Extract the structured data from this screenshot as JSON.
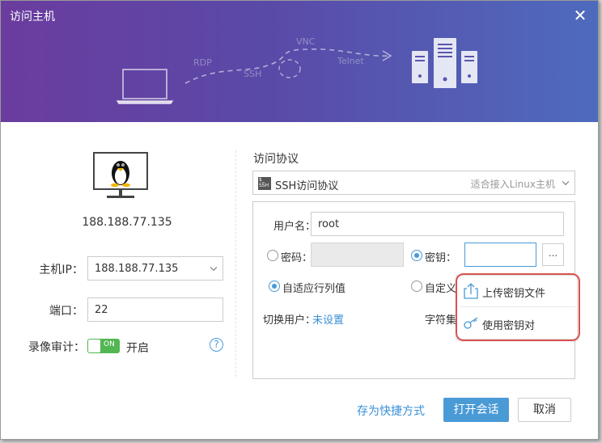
{
  "window": {
    "title": "访问主机",
    "close_glyph": "✕"
  },
  "banner": {
    "protocols": [
      "RDP",
      "SSH",
      "VNC",
      "Telnet"
    ]
  },
  "host": {
    "ip_display": "188.188.77.135",
    "ip_label": "主机IP：",
    "ip_value": "188.188.77.135",
    "port_label": "端口：",
    "port_value": "22",
    "record_label": "录像审计：",
    "record_toggle_text": "ON",
    "record_state": "开启",
    "help_glyph": "?"
  },
  "protocol": {
    "section_title": "访问协议",
    "selected": "SSH访问协议",
    "hint": "适合接入Linux主机",
    "icon_text": "$_\nSSH"
  },
  "auth": {
    "username_label": "用户名：",
    "username_value": "root",
    "password_label": "密码：",
    "key_label": "密钥：",
    "dots_label": "...",
    "adaptive_label": "自适应行列值",
    "custom_label": "自定义",
    "switch_user_label": "切换用户：",
    "switch_user_value": "未设置",
    "charset_label": "字符集"
  },
  "key_menu": {
    "items": [
      {
        "label": "上传密钥文件",
        "icon": "upload-icon"
      },
      {
        "label": "使用密钥对",
        "icon": "key-icon"
      }
    ]
  },
  "footer": {
    "save_shortcut": "存为快捷方式",
    "open_session": "打开会话",
    "cancel": "取消"
  },
  "colors": {
    "accent": "#4a9ad6",
    "toggle_on": "#52b652",
    "highlight": "#d9534f"
  }
}
